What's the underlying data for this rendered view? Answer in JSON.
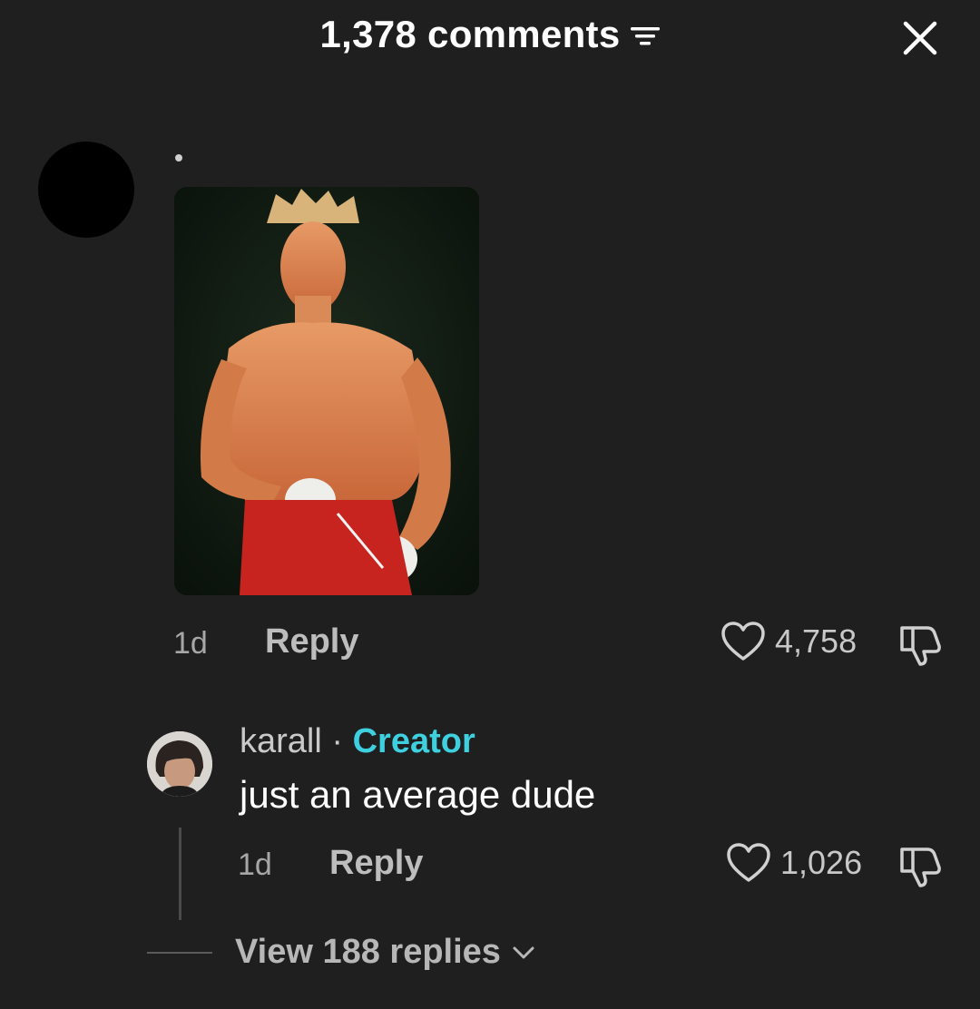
{
  "header": {
    "title": "1,378 comments"
  },
  "comment": {
    "time": "1d",
    "reply_label": "Reply",
    "likes": "4,758"
  },
  "reply": {
    "username": "karall",
    "separator": "·",
    "badge": "Creator",
    "text": "just an average dude",
    "time": "1d",
    "reply_label": "Reply",
    "likes": "1,026"
  },
  "view_replies": {
    "label": "View 188 replies"
  },
  "icons": {
    "filter": "filter-icon",
    "close": "close-icon",
    "like": "heart-icon",
    "dislike": "thumbs-down-icon",
    "expand": "chevron-down-icon"
  },
  "colors": {
    "background": "#1f1f1f",
    "creator_badge": "#3fd0e0"
  }
}
